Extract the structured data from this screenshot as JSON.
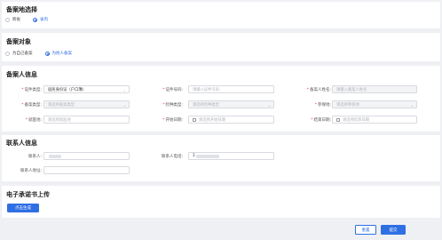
{
  "section_location": {
    "title": "备案地选择",
    "options": [
      {
        "label": "跨省",
        "selected": false
      },
      {
        "label": "省内",
        "selected": true
      }
    ]
  },
  "section_target": {
    "title": "备案对象",
    "options": [
      {
        "label": "为自己备案",
        "selected": false
      },
      {
        "label": "为他人备案",
        "selected": true
      }
    ]
  },
  "section_person": {
    "title": "备案人信息",
    "fields": {
      "id_type": {
        "label": "证件类型:",
        "value": "居民身份证（户口簿）"
      },
      "id_number": {
        "label": "证件号码:",
        "placeholder": "请输入证件号码"
      },
      "name": {
        "label": "备案人姓名:",
        "placeholder": "请输入备案人姓名"
      },
      "category": {
        "label": "备案类型:",
        "placeholder": "请选择备案类型"
      },
      "insurance_type": {
        "label": "险种类型:",
        "placeholder": "请选择险种类型"
      },
      "insured_area": {
        "label": "参保地:",
        "placeholder": "请选择参保地"
      },
      "residence": {
        "label": "就医地:",
        "placeholder": "请选择就医地"
      },
      "start_date": {
        "label": "开始日期:",
        "placeholder": "请选择开始日期"
      },
      "end_date": {
        "label": "结束日期:",
        "placeholder": "请选择结束日期"
      }
    }
  },
  "section_contact": {
    "title": "联系人信息",
    "contact_name_label": "联系人:",
    "contact_phone_label": "联系人电话:",
    "contact_phone_value": "1",
    "contact_address_label": "联系人地址:"
  },
  "section_upload": {
    "title": "电子承诺书上传",
    "generate_button": "点击生成"
  },
  "footer": {
    "reset_button": "重置",
    "submit_button": "提交"
  },
  "colors": {
    "accent": "#2f6fe4",
    "required": "#e53935"
  }
}
